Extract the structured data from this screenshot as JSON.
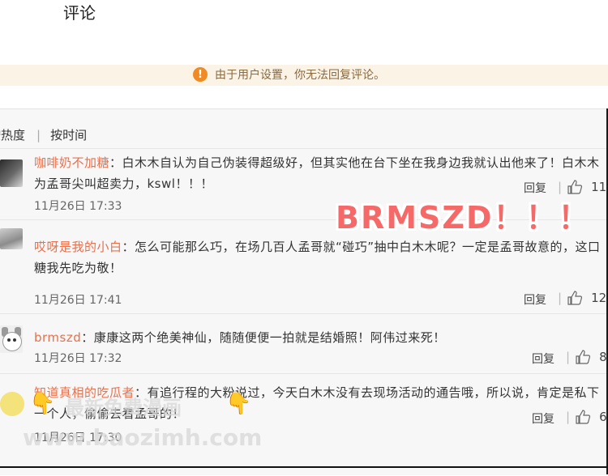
{
  "page": {
    "title": "评论"
  },
  "notice": {
    "icon": "!",
    "text": "由于用户设置，你无法回复评论。"
  },
  "sort": {
    "hot": "按热度",
    "time": "按时间",
    "separator": "|"
  },
  "comments": [
    {
      "user": "咖啡奶不加糖",
      "content": "：白木木自认为自己伪装得超级好，但其实他在台下坐在我身边我就认出他来了！白木木为孟哥尖叫超卖力，kswl！！！",
      "time": "11月26日 17:33",
      "reply": "回复",
      "likes": "11"
    },
    {
      "user": "哎呀是我的小白",
      "content": "：怎么可能那么巧，在场几百人孟哥就“碰巧”抽中白木木呢？一定是孟哥故意的，这口糖我先吃为敬！",
      "time": "11月26日 17:41",
      "reply": "回复",
      "likes": "12"
    },
    {
      "user": "brmszd",
      "content": "：康康这两个绝美神仙，随随便便一拍就是结婚照！阿伟过来死！",
      "time": "11月26日 17:32",
      "reply": "回复",
      "likes": "8"
    },
    {
      "user": "知道真相的吃瓜者",
      "content": "：有追行程的大粉说过，今天白木木没有去现场活动的通告哦，所以说，肯定是私下一个人，偷偷去看孟哥的！",
      "time": "11月26日 17:30",
      "reply": "回复",
      "likes": "6"
    }
  ],
  "overlay": {
    "text": "BRMSZD！！！"
  },
  "watermark": {
    "line1": "最新免费漫画",
    "line2": "www.baozimh.com"
  },
  "colors": {
    "username": "#e8704c",
    "notice_bg": "#fbf3e6",
    "warn_icon": "#f08a24",
    "overlay": "#f56a68"
  }
}
